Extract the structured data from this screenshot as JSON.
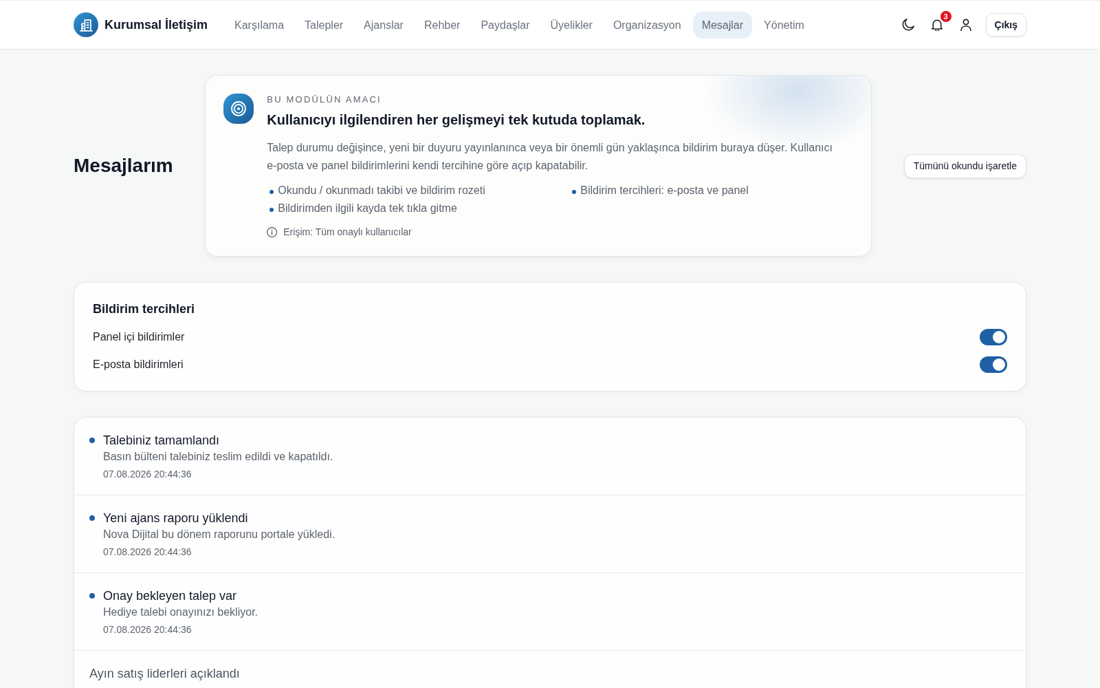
{
  "header": {
    "brand": "Kurumsal İletişim",
    "nav": [
      {
        "label": "Karşılama",
        "selected": false
      },
      {
        "label": "Talepler",
        "selected": false
      },
      {
        "label": "Ajanslar",
        "selected": false
      },
      {
        "label": "Rehber",
        "selected": false
      },
      {
        "label": "Paydaşlar",
        "selected": false
      },
      {
        "label": "Üyelikler",
        "selected": false
      },
      {
        "label": "Organizasyon",
        "selected": false
      },
      {
        "label": "Mesajlar",
        "selected": true
      },
      {
        "label": "Yönetim",
        "selected": false
      }
    ],
    "notification_count": "3",
    "logout_button": "Çıkış"
  },
  "page": {
    "title": "Mesajlarım",
    "mark_all_button": "Tümünü okundu işaretle"
  },
  "purpose_card": {
    "eyebrow": "BU MODÜLÜN AMACI",
    "heading": "Kullanıcıyı ilgilendiren her gelişmeyi tek kutuda toplamak.",
    "description": "Talep durumu değişince, yeni bir duyuru yayınlanınca veya bir önemli gün yaklaşınca bildirim buraya düşer. Kullanıcı e-posta ve panel bildirimlerini kendi tercihine göre açıp kapatabilir.",
    "features": [
      "Okundu / okunmadı takibi ve bildirim rozeti",
      "Bildirim tercihleri: e-posta ve panel",
      "Bildirimden ilgili kayda tek tıkla gitme"
    ],
    "access": "Erişim: Tüm onaylı kullanıcılar"
  },
  "preferences": {
    "title": "Bildirim tercihleri",
    "options": [
      {
        "label": "Panel içi bildirimler",
        "on": true
      },
      {
        "label": "E-posta bildirimleri",
        "on": true
      }
    ]
  },
  "notifications": [
    {
      "title": "Talebiniz tamamlandı",
      "message": "Basın bülteni talebiniz teslim edildi ve kapatıldı.",
      "time": "07.08.2026 20:44:36",
      "unread": true
    },
    {
      "title": "Yeni ajans raporu yüklendi",
      "message": "Nova Dijital bu dönem raporunu portale yükledi.",
      "time": "07.08.2026 20:44:36",
      "unread": true
    },
    {
      "title": "Onay bekleyen talep var",
      "message": "Hediye talebi onayınızı bekliyor.",
      "time": "07.08.2026 20:44:36",
      "unread": true
    },
    {
      "title": "Ayın satış liderleri açıklandı",
      "unread": false
    }
  ]
}
